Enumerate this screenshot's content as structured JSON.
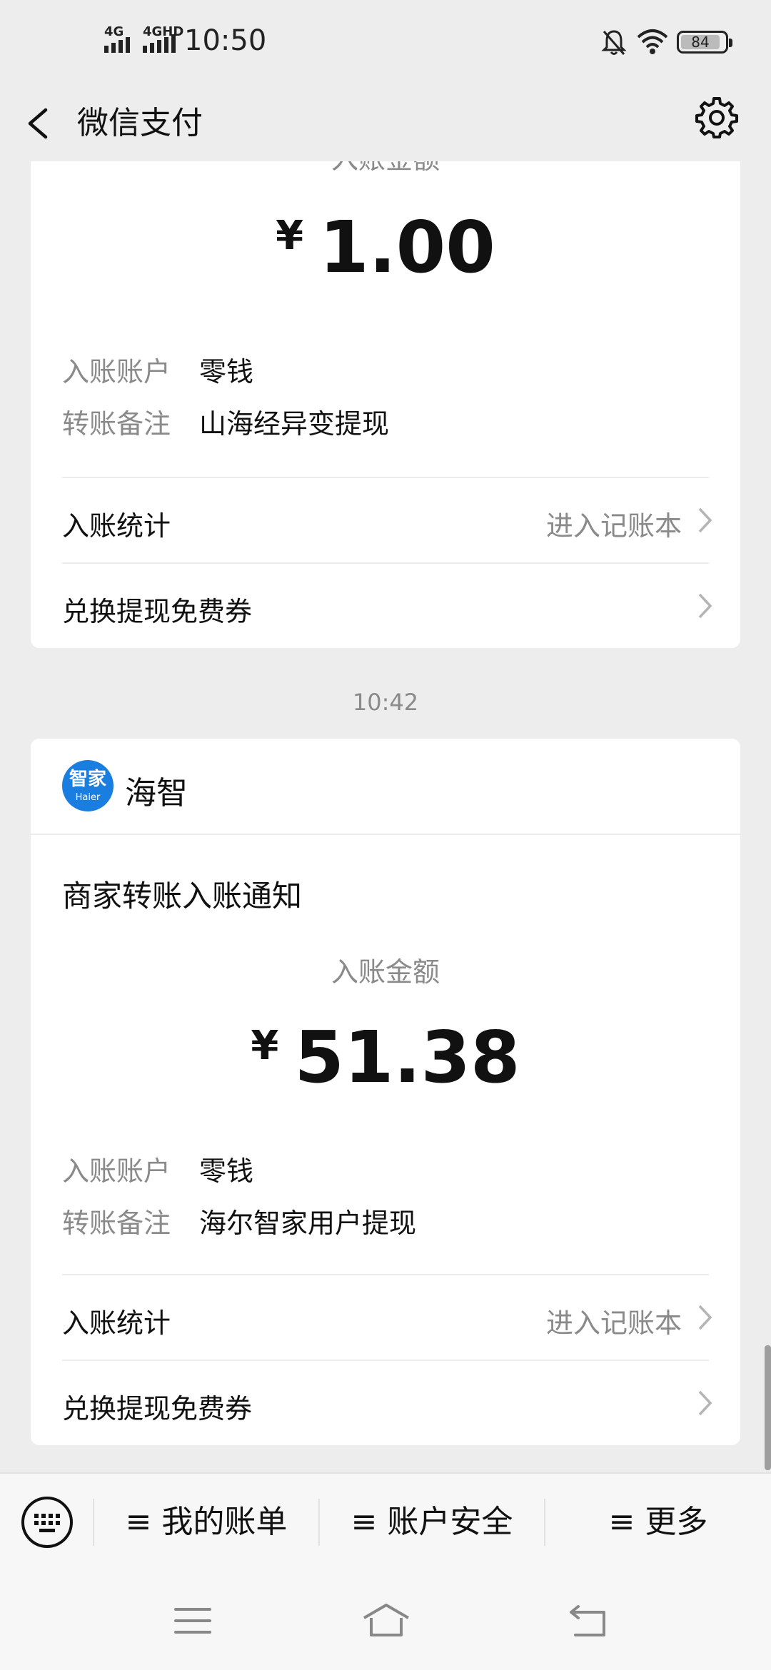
{
  "status_bar": {
    "signal1": "4G",
    "signal2": "4GHD",
    "time": "10:50",
    "battery": "84"
  },
  "nav": {
    "title": "微信支付"
  },
  "card1": {
    "amount_label": "入账金额",
    "currency": "¥",
    "amount": "1.00",
    "account_label": "入账账户",
    "account_value": "零钱",
    "note_label": "转账备注",
    "note_value": "山海经异变提现",
    "stats_label": "入账统计",
    "stats_link": "进入记账本",
    "voucher_label": "兑换提现免费券"
  },
  "timestamp": "10:42",
  "card2": {
    "merchant_logo_top": "智家",
    "merchant_logo_bottom": "Haier",
    "merchant_name": "海智",
    "headline": "商家转账入账通知",
    "amount_label": "入账金额",
    "currency": "¥",
    "amount": "51.38",
    "account_label": "入账账户",
    "account_value": "零钱",
    "note_label": "转账备注",
    "note_value": "海尔智家用户提现",
    "stats_label": "入账统计",
    "stats_link": "进入记账本",
    "voucher_label": "兑换提现免费券"
  },
  "bottom_menu": {
    "bills": "≡ 我的账单",
    "security": "≡ 账户安全",
    "more": "≡ 更多"
  },
  "colors": {
    "background": "#ededed",
    "card": "#ffffff",
    "secondary_text": "#8a8a8a",
    "logo_blue": "#1a7ee0"
  }
}
